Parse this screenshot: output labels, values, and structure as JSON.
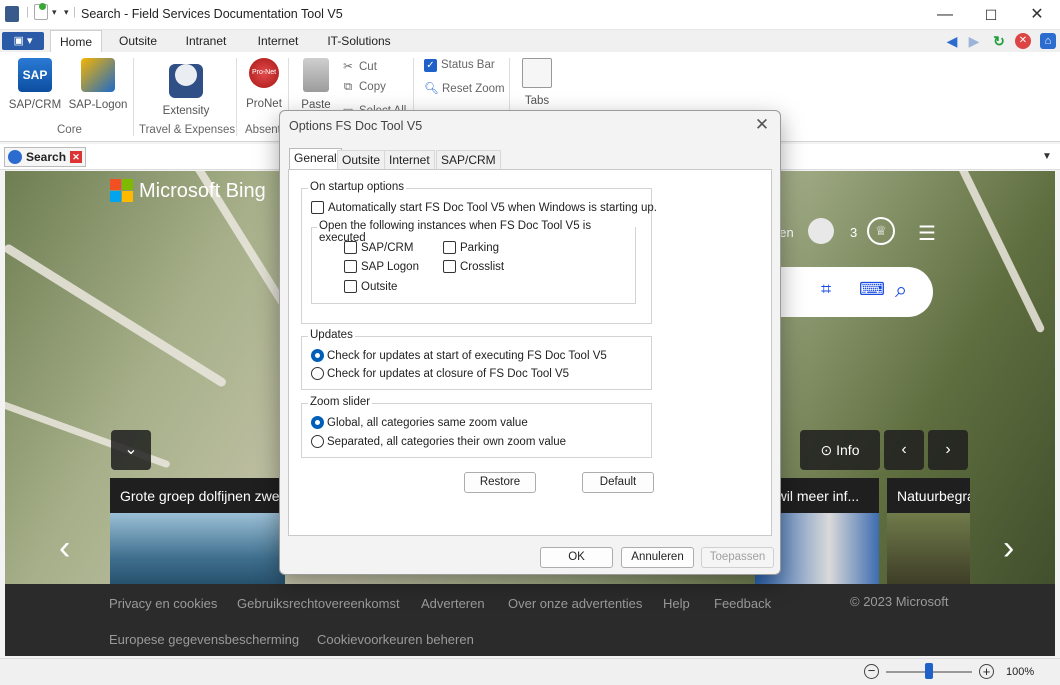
{
  "window": {
    "title": "Search - Field Services Documentation Tool V5",
    "minimize": "—",
    "maximize": "☐",
    "close": "✕"
  },
  "ribbon_tabs": [
    "Home",
    "Outsite",
    "Intranet",
    "Internet",
    "IT-Solutions"
  ],
  "ribbon": {
    "sap_crm": "SAP/CRM",
    "sap_logon": "SAP-Logon",
    "extensity": "Extensity",
    "pronet": "ProNet",
    "pronet_icon_text": "Pro-Net",
    "paste": "Paste",
    "cut": "Cut",
    "copy": "Copy",
    "select_all": "Select All",
    "status_bar": "Status Bar",
    "reset_zoom": "Reset Zoom",
    "tabs": "Tabs",
    "group_core": "Core",
    "group_travel": "Travel & Expenses",
    "group_absent": "Absent"
  },
  "browser_tab": {
    "label": "Search"
  },
  "bing": {
    "logo_text": "Microsoft Bing",
    "signin_partial": "den",
    "rewards_count": "3",
    "info_label": "Info",
    "cards": [
      {
        "title": "Grote groep dolfijnen zwe..."
      },
      {
        "title": "n wil meer inf..."
      },
      {
        "title": "Natuurbegra"
      }
    ],
    "footer_links": [
      "Privacy en cookies",
      "Gebruiksrechtovereenkomst",
      "Adverteren",
      "Over onze advertenties",
      "Help",
      "Feedback",
      "Europese gegevensbescherming",
      "Cookievoorkeuren beheren"
    ],
    "copyright": "© 2023 Microsoft"
  },
  "status_bar": {
    "zoom": "100%",
    "zoom_level": 0.5
  },
  "dialog": {
    "title": "Options FS Doc Tool V5",
    "tabs": [
      "General",
      "Outsite",
      "Internet",
      "SAP/CRM"
    ],
    "startup": {
      "legend": "On startup options",
      "auto_start": "Automatically start FS Doc Tool V5 when Windows is starting up.",
      "instances_legend": "Open the following instances when FS Doc Tool V5 is executed",
      "options": [
        "SAP/CRM",
        "Parking",
        "SAP Logon",
        "Crosslist",
        "Outsite"
      ]
    },
    "updates": {
      "legend": "Updates",
      "opt1": "Check for updates at start of executing FS Doc Tool V5",
      "opt2": "Check for updates at closure of FS Doc Tool V5"
    },
    "zoom": {
      "legend": "Zoom slider",
      "opt1": "Global, all categories same zoom value",
      "opt2": "Separated, all categories their own zoom value"
    },
    "restore": "Restore",
    "default": "Default",
    "ok": "OK",
    "cancel": "Annuleren",
    "apply": "Toepassen"
  }
}
